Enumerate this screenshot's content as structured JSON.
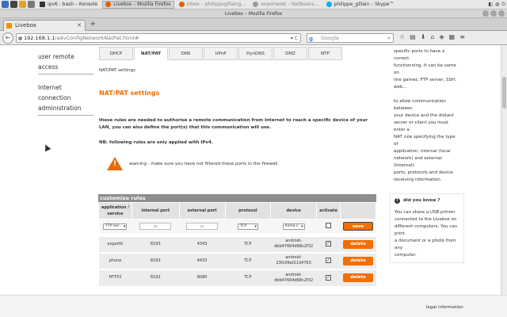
{
  "taskbar": {
    "tasks": [
      {
        "label": "ipv6 : bash – Konsole",
        "state": "normal"
      },
      {
        "label": "Livebox – Mozilla Firefox",
        "state": "active"
      },
      {
        "label": "Inbox – philippegillaing...",
        "state": "dim"
      },
      {
        "label": "exportweb – NetBeans...",
        "state": "dim"
      },
      {
        "label": "philippe_gillain – Skype™",
        "state": "normal"
      }
    ]
  },
  "window": {
    "title": "Livebox – Mozilla Firefox"
  },
  "browser": {
    "tab_label": "Livebox",
    "url_domain": "192.168.1.1",
    "url_path": "/advConfigNetworkNatPat.html#",
    "search_placeholder": "Google"
  },
  "leftnav": {
    "items": [
      {
        "lines": [
          "user remote",
          "access"
        ]
      },
      {
        "lines": [
          "Internet",
          "connection",
          "administration"
        ]
      }
    ]
  },
  "tabs": [
    "DHCP",
    "NAT/PAT",
    "DNS",
    "UPnP",
    "DynDNS",
    "DMZ",
    "NTP"
  ],
  "selected_tab": "NAT/PAT",
  "breadcrumb": "NAT/PAT settings",
  "section_title": "NAT/PAT settings",
  "description": "these rules are needed to authorise a remote communication from Internet to reach a specific device of your LAN, you can also define the port(s) that this communication will use.",
  "note": "NB: following rules are only applied with IPv4.",
  "warning": "warning : make sure you have not filtered these ports in the firewall.",
  "rules": {
    "title": "customize rules",
    "headers": {
      "application": "application / service",
      "internal": "internal port",
      "external": "external port",
      "protocol": "protocol",
      "device": "device",
      "activate": "activate"
    },
    "input": {
      "application": "FTP Ser...",
      "internal_placeholder": "21",
      "external_placeholder": "21",
      "protocol": "TCP",
      "device": "home-c",
      "save_label": "save"
    },
    "rows": [
      {
        "app": "exportit",
        "internal": "8193",
        "external": "4343",
        "protocol": "TCP",
        "device_l1": "android-",
        "device_l2": "dbb47664d68c2f32",
        "checked": "✓",
        "delete": "delete"
      },
      {
        "app": "phone",
        "internal": "8193",
        "external": "4433",
        "protocol": "TCP",
        "device_l1": "android-",
        "device_l2": "23fc09af2134763",
        "checked": "✓",
        "delete": "delete"
      },
      {
        "app": "HTTP2",
        "internal": "8192",
        "external": "8080",
        "protocol": "TCP",
        "device_l1": "android-",
        "device_l2": "dbb47664d68c2f32",
        "checked": "✓",
        "delete": "delete"
      }
    ]
  },
  "sidebar_help": {
    "lines1": [
      "specific ports to have a correct",
      "functionning. It can be some on",
      "line games, FTP server, SSH,",
      "web…"
    ],
    "lines2": [
      "to allow communication between",
      "your device and the distant",
      "server or client you must enter a",
      "NAT rule specifying the type of",
      "application, internal (local",
      "network) and external (Internet)",
      "ports, protocols and device",
      "receiving information."
    ],
    "did_you_know": "did you know ?",
    "lines3": [
      "You can share a USB printer",
      "connected to the Livebox on",
      "different computers. You can print",
      "a document or a photo from any",
      "computer."
    ]
  },
  "footer": {
    "legal": "legal information"
  }
}
